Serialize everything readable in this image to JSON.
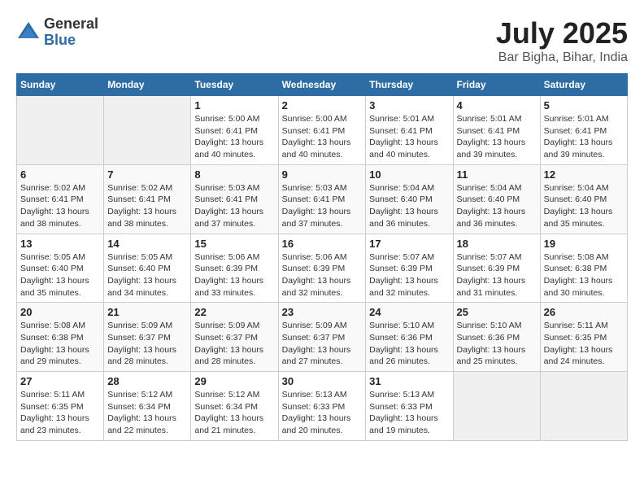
{
  "header": {
    "logo_general": "General",
    "logo_blue": "Blue",
    "month_title": "July 2025",
    "location": "Bar Bigha, Bihar, India"
  },
  "days_of_week": [
    "Sunday",
    "Monday",
    "Tuesday",
    "Wednesday",
    "Thursday",
    "Friday",
    "Saturday"
  ],
  "weeks": [
    [
      {
        "day": "",
        "info": ""
      },
      {
        "day": "",
        "info": ""
      },
      {
        "day": "1",
        "sunrise": "5:00 AM",
        "sunset": "6:41 PM",
        "daylight": "13 hours and 40 minutes."
      },
      {
        "day": "2",
        "sunrise": "5:00 AM",
        "sunset": "6:41 PM",
        "daylight": "13 hours and 40 minutes."
      },
      {
        "day": "3",
        "sunrise": "5:01 AM",
        "sunset": "6:41 PM",
        "daylight": "13 hours and 40 minutes."
      },
      {
        "day": "4",
        "sunrise": "5:01 AM",
        "sunset": "6:41 PM",
        "daylight": "13 hours and 39 minutes."
      },
      {
        "day": "5",
        "sunrise": "5:01 AM",
        "sunset": "6:41 PM",
        "daylight": "13 hours and 39 minutes."
      }
    ],
    [
      {
        "day": "6",
        "sunrise": "5:02 AM",
        "sunset": "6:41 PM",
        "daylight": "13 hours and 38 minutes."
      },
      {
        "day": "7",
        "sunrise": "5:02 AM",
        "sunset": "6:41 PM",
        "daylight": "13 hours and 38 minutes."
      },
      {
        "day": "8",
        "sunrise": "5:03 AM",
        "sunset": "6:41 PM",
        "daylight": "13 hours and 37 minutes."
      },
      {
        "day": "9",
        "sunrise": "5:03 AM",
        "sunset": "6:41 PM",
        "daylight": "13 hours and 37 minutes."
      },
      {
        "day": "10",
        "sunrise": "5:04 AM",
        "sunset": "6:40 PM",
        "daylight": "13 hours and 36 minutes."
      },
      {
        "day": "11",
        "sunrise": "5:04 AM",
        "sunset": "6:40 PM",
        "daylight": "13 hours and 36 minutes."
      },
      {
        "day": "12",
        "sunrise": "5:04 AM",
        "sunset": "6:40 PM",
        "daylight": "13 hours and 35 minutes."
      }
    ],
    [
      {
        "day": "13",
        "sunrise": "5:05 AM",
        "sunset": "6:40 PM",
        "daylight": "13 hours and 35 minutes."
      },
      {
        "day": "14",
        "sunrise": "5:05 AM",
        "sunset": "6:40 PM",
        "daylight": "13 hours and 34 minutes."
      },
      {
        "day": "15",
        "sunrise": "5:06 AM",
        "sunset": "6:39 PM",
        "daylight": "13 hours and 33 minutes."
      },
      {
        "day": "16",
        "sunrise": "5:06 AM",
        "sunset": "6:39 PM",
        "daylight": "13 hours and 32 minutes."
      },
      {
        "day": "17",
        "sunrise": "5:07 AM",
        "sunset": "6:39 PM",
        "daylight": "13 hours and 32 minutes."
      },
      {
        "day": "18",
        "sunrise": "5:07 AM",
        "sunset": "6:39 PM",
        "daylight": "13 hours and 31 minutes."
      },
      {
        "day": "19",
        "sunrise": "5:08 AM",
        "sunset": "6:38 PM",
        "daylight": "13 hours and 30 minutes."
      }
    ],
    [
      {
        "day": "20",
        "sunrise": "5:08 AM",
        "sunset": "6:38 PM",
        "daylight": "13 hours and 29 minutes."
      },
      {
        "day": "21",
        "sunrise": "5:09 AM",
        "sunset": "6:37 PM",
        "daylight": "13 hours and 28 minutes."
      },
      {
        "day": "22",
        "sunrise": "5:09 AM",
        "sunset": "6:37 PM",
        "daylight": "13 hours and 28 minutes."
      },
      {
        "day": "23",
        "sunrise": "5:09 AM",
        "sunset": "6:37 PM",
        "daylight": "13 hours and 27 minutes."
      },
      {
        "day": "24",
        "sunrise": "5:10 AM",
        "sunset": "6:36 PM",
        "daylight": "13 hours and 26 minutes."
      },
      {
        "day": "25",
        "sunrise": "5:10 AM",
        "sunset": "6:36 PM",
        "daylight": "13 hours and 25 minutes."
      },
      {
        "day": "26",
        "sunrise": "5:11 AM",
        "sunset": "6:35 PM",
        "daylight": "13 hours and 24 minutes."
      }
    ],
    [
      {
        "day": "27",
        "sunrise": "5:11 AM",
        "sunset": "6:35 PM",
        "daylight": "13 hours and 23 minutes."
      },
      {
        "day": "28",
        "sunrise": "5:12 AM",
        "sunset": "6:34 PM",
        "daylight": "13 hours and 22 minutes."
      },
      {
        "day": "29",
        "sunrise": "5:12 AM",
        "sunset": "6:34 PM",
        "daylight": "13 hours and 21 minutes."
      },
      {
        "day": "30",
        "sunrise": "5:13 AM",
        "sunset": "6:33 PM",
        "daylight": "13 hours and 20 minutes."
      },
      {
        "day": "31",
        "sunrise": "5:13 AM",
        "sunset": "6:33 PM",
        "daylight": "13 hours and 19 minutes."
      },
      {
        "day": "",
        "info": ""
      },
      {
        "day": "",
        "info": ""
      }
    ]
  ],
  "daylight_label": "Daylight hours",
  "sunrise_label": "Sunrise:",
  "sunset_label": "Sunset:"
}
